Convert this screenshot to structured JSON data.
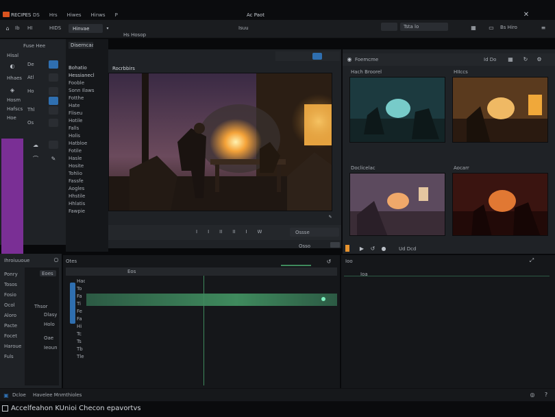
{
  "titlebar": {
    "app_name": "RECIPES",
    "menu_items": [
      "DS",
      "Hrs",
      "Hiwes",
      "Hinws",
      "P"
    ],
    "center_title": "Ac Paot"
  },
  "menubar": {
    "left_items": [
      "Ib",
      "HI"
    ],
    "tab_label": "HIDS",
    "tab_active": "Hinvae",
    "breadcrumb": "Hs Hosop",
    "center_label": "Isuu",
    "dropdown_value": "Tsta lo",
    "right_label": "Bs Hiro"
  },
  "sidebar": {
    "header": "Fuse Hee",
    "items": [
      "Hisal",
      "Hhaes",
      "Hosm",
      "Hafscs",
      "Hoe"
    ],
    "tool_labels": [
      "De",
      "Atl",
      "Ho",
      "Thl",
      "Os"
    ]
  },
  "browser": {
    "tab_label": "Diserncaa",
    "tree_header": "Bohatio",
    "tree_items": [
      "Hessianecl",
      "Fooble",
      "Sonn Ilaws",
      "Fotthe",
      "Hate",
      "Fliseu",
      "Hotile",
      "Falls",
      "Holis",
      "Hatbloe",
      "Fotile",
      "Hasle",
      "Hosite",
      "Tohlio",
      "Fassfe",
      "Aogles",
      "Hhstile",
      "Hhlatis",
      "Fawpie"
    ]
  },
  "viewer": {
    "title": "Rocrbbirs",
    "transport_labels": [
      "I",
      "I",
      "II",
      "II",
      "I",
      "W"
    ],
    "right_button": "Ossse",
    "bottom_button": "Osso"
  },
  "gallery": {
    "header": "Foemcme",
    "header_right": "Id Do",
    "thumbs": [
      {
        "label": "Hach Broorel"
      },
      {
        "label": "HIIccs"
      },
      {
        "label": "Doclicelac"
      },
      {
        "label": "Aocarr"
      }
    ],
    "footer": "Ud Dcd"
  },
  "props": {
    "header": "Ihroiuuoue",
    "labels": [
      "Ponry",
      "Tosos",
      "Fosio",
      "Ocol",
      "Aloro",
      "Pacte",
      "Focet",
      "Haroue",
      "Fuls"
    ],
    "mid_labels": [
      "Eoes",
      "Thsor",
      "Dlasy",
      "Holo",
      "Oae",
      "Ieoun"
    ]
  },
  "timeline": {
    "label": "Otes",
    "track_label": "Eos",
    "track_names": [
      "Hao",
      "To",
      "Fa",
      "Ti",
      "Fe",
      "Fa",
      "Hi",
      "Tc",
      "Ts",
      "Tb",
      "Tle"
    ],
    "right_label": "Ioo",
    "right_small": "Ioa"
  },
  "status": {
    "left": "Dcloe",
    "text": "Havelee Mnmthioles"
  },
  "caption": {
    "text": "Accelfeahon KUnioi Checon epavortvs"
  },
  "colors": {
    "accent": "#2f6fb0",
    "purple": "#7a2f95",
    "green": "#3f8a5d",
    "fire": "#e8932e"
  }
}
